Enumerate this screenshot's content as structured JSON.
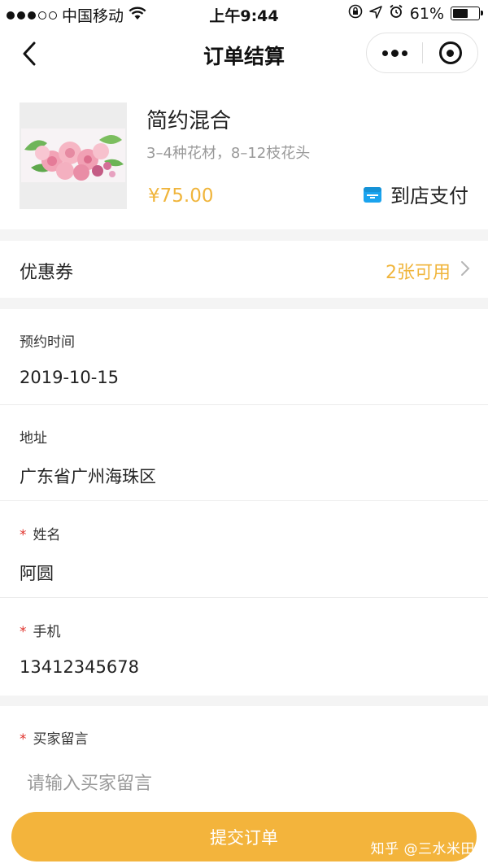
{
  "status_bar": {
    "carrier": "中国移动",
    "time": "上午9:44",
    "battery_percent": "61%",
    "battery_level": 0.61,
    "icons": [
      "signal-dots-icon",
      "wifi-icon",
      "rotation-lock-icon",
      "location-arrow-icon",
      "alarm-icon",
      "battery-icon"
    ]
  },
  "nav": {
    "title": "订单结算",
    "icons": [
      "back-chevron-icon",
      "more-dots-icon",
      "close-target-icon"
    ]
  },
  "product": {
    "name": "简约混合",
    "description": "3–4种花材，8–12枝花头",
    "price": "¥75.00",
    "payment_method": "到店支付",
    "image_subject": "pink-roses",
    "colors": {
      "price": "#f0b53c",
      "pay_icon": "#1aa3ee"
    }
  },
  "coupon": {
    "label": "优惠券",
    "value": "2张可用"
  },
  "form": {
    "fields": [
      {
        "label": "预约时间",
        "required": false,
        "value": "2019-10-15"
      },
      {
        "label": "地址",
        "required": false,
        "value": "广东省广州海珠区"
      },
      {
        "label": "姓名",
        "required": true,
        "value": "阿圆"
      },
      {
        "label": "手机",
        "required": true,
        "value": "13412345678"
      }
    ],
    "required_mark": "*"
  },
  "message": {
    "label": "买家留言",
    "required": true,
    "placeholder": "请输入买家留言"
  },
  "submit": {
    "label": "提交订单",
    "color": "#f3b43c"
  },
  "watermark": "知乎 @三水米田"
}
